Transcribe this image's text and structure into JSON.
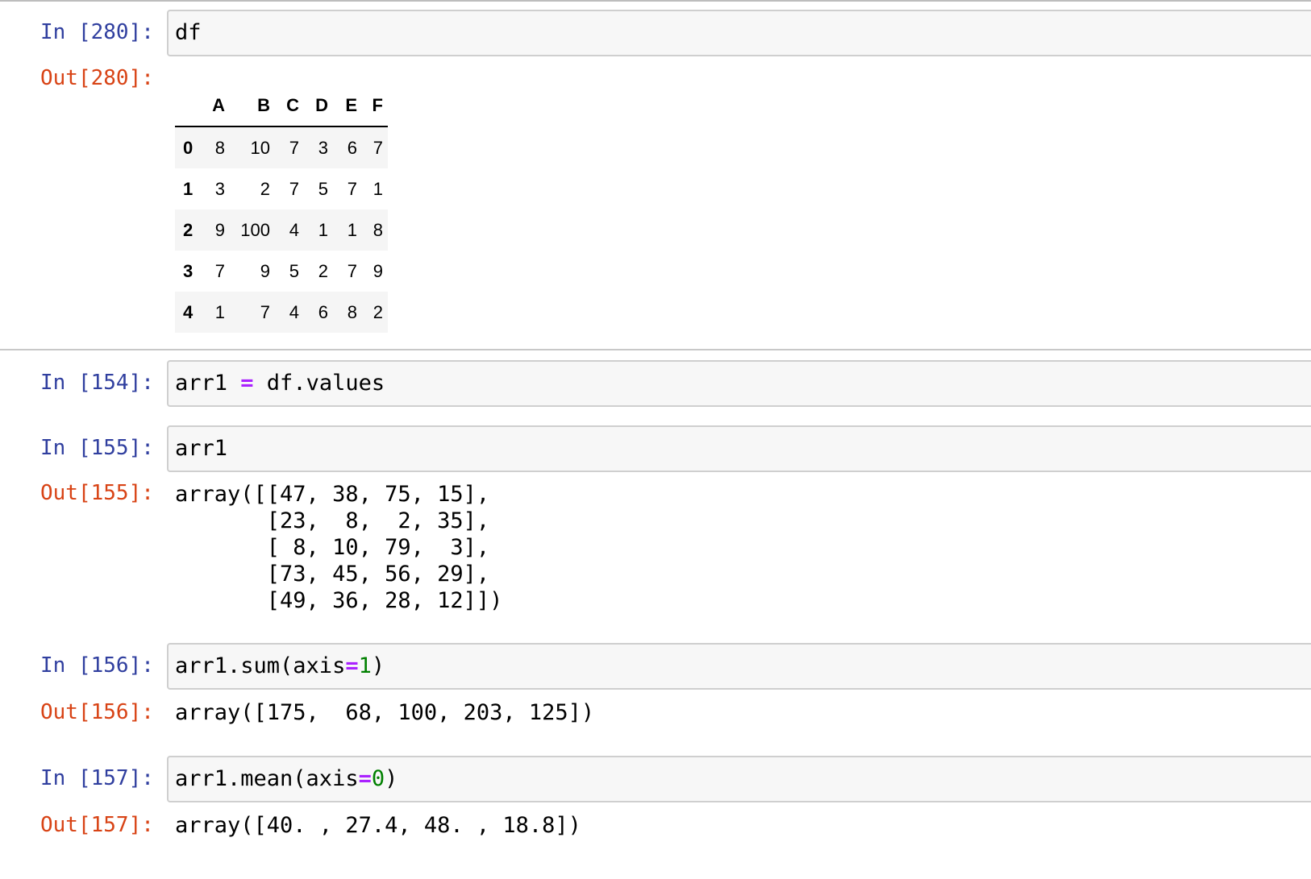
{
  "cells": [
    {
      "in_prompt": "In [280]:",
      "code": "df",
      "out_prompt": "Out[280]:",
      "table": {
        "columns": [
          "",
          "A",
          "B",
          "C",
          "D",
          "E",
          "F"
        ],
        "rows": [
          {
            "index": "0",
            "values": [
              "8",
              "10",
              "7",
              "3",
              "6",
              "7"
            ]
          },
          {
            "index": "1",
            "values": [
              "3",
              "2",
              "7",
              "5",
              "7",
              "1"
            ]
          },
          {
            "index": "2",
            "values": [
              "9",
              "100",
              "4",
              "1",
              "1",
              "8"
            ]
          },
          {
            "index": "3",
            "values": [
              "7",
              "9",
              "5",
              "2",
              "7",
              "9"
            ]
          },
          {
            "index": "4",
            "values": [
              "1",
              "7",
              "4",
              "6",
              "8",
              "2"
            ]
          }
        ]
      }
    },
    {
      "in_prompt": "In [154]:",
      "code_parts": {
        "a": "arr1 ",
        "op": "=",
        "b": " df.values"
      }
    },
    {
      "in_prompt": "In [155]:",
      "code": "arr1",
      "out_prompt": "Out[155]:",
      "output_lines": [
        "array([[47, 38, 75, 15],",
        "       [23,  8,  2, 35],",
        "       [ 8, 10, 79,  3],",
        "       [73, 45, 56, 29],",
        "       [49, 36, 28, 12]])"
      ]
    },
    {
      "in_prompt": "In [156]:",
      "code_parts": {
        "a": "arr1.sum(axis",
        "op": "=",
        "num": "1",
        "b": ")"
      },
      "out_prompt": "Out[156]:",
      "output": "array([175,  68, 100, 203, 125])"
    },
    {
      "in_prompt": "In [157]:",
      "code_parts": {
        "a": "arr1.mean(axis",
        "op": "=",
        "num": "0",
        "b": ")"
      },
      "out_prompt": "Out[157]:",
      "output": "array([40. , 27.4, 48. , 18.8])"
    }
  ],
  "colors": {
    "in_prompt": "#303f9f",
    "out_prompt": "#d84315",
    "operator": "#aa22ff",
    "number": "#008000",
    "input_bg": "#f7f7f7"
  }
}
